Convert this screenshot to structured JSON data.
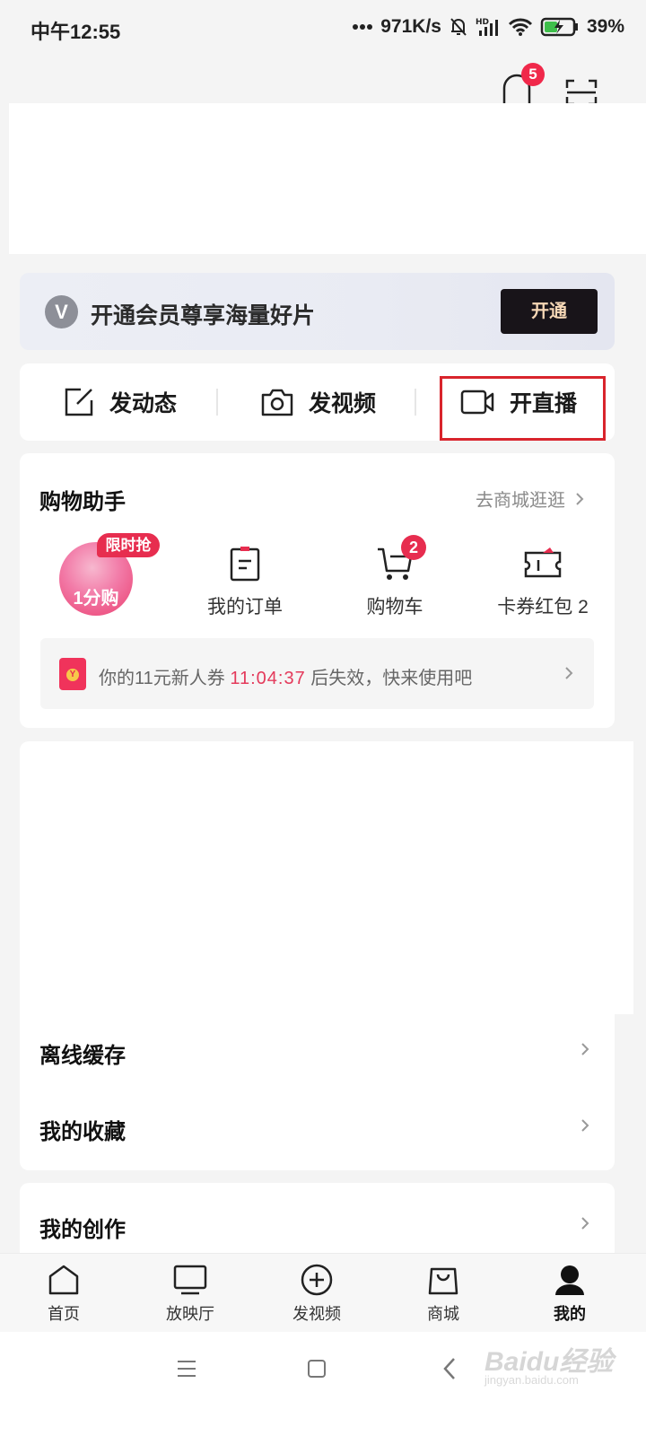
{
  "status_bar": {
    "time": "中午12:55",
    "network_speed": "971K/s",
    "battery": "39%",
    "icons": [
      "dots-icon",
      "mute-bell-icon",
      "hd-signal-icon",
      "wifi-icon",
      "battery-charging-icon"
    ]
  },
  "header": {
    "notification_count": "5",
    "icons": [
      "bell-icon",
      "scan-icon"
    ]
  },
  "vip_banner": {
    "logo_letter": "V",
    "text": "开通会员尊享海量好片",
    "button": "开通"
  },
  "actions": [
    {
      "label": "发动态",
      "icon": "edit-icon"
    },
    {
      "label": "发视频",
      "icon": "camera-icon"
    },
    {
      "label": "开直播",
      "icon": "live-video-icon"
    }
  ],
  "shopping": {
    "title": "购物助手",
    "link": "去商城逛逛",
    "promo": {
      "tag": "限时抢",
      "text": "1分购"
    },
    "items": [
      {
        "label": "我的订单",
        "icon": "order-icon"
      },
      {
        "label": "购物车",
        "icon": "cart-icon",
        "badge": "2"
      },
      {
        "label": "卡券红包 2",
        "icon": "coupon-icon"
      }
    ],
    "coupon": {
      "prefix": "你的11元新人券",
      "time": "11:04:37",
      "suffix": "后失效，快来使用吧",
      "icon_letter": "Y"
    }
  },
  "list": [
    {
      "label": "离线缓存"
    },
    {
      "label": "我的收藏"
    },
    {
      "label": "我的创作"
    }
  ],
  "bottom_nav": [
    {
      "label": "首页",
      "icon": "home-icon"
    },
    {
      "label": "放映厅",
      "icon": "tv-icon"
    },
    {
      "label": "发视频",
      "icon": "plus-circle-icon"
    },
    {
      "label": "商城",
      "icon": "shopping-bag-icon"
    },
    {
      "label": "我的",
      "icon": "profile-icon",
      "active": true
    }
  ],
  "watermark": {
    "text": "Baidu经验",
    "sub": "jingyan.baidu.com"
  },
  "colors": {
    "accent": "#e72d4f",
    "highlight_box": "#d9242c",
    "vip_button_bg": "#181419"
  }
}
